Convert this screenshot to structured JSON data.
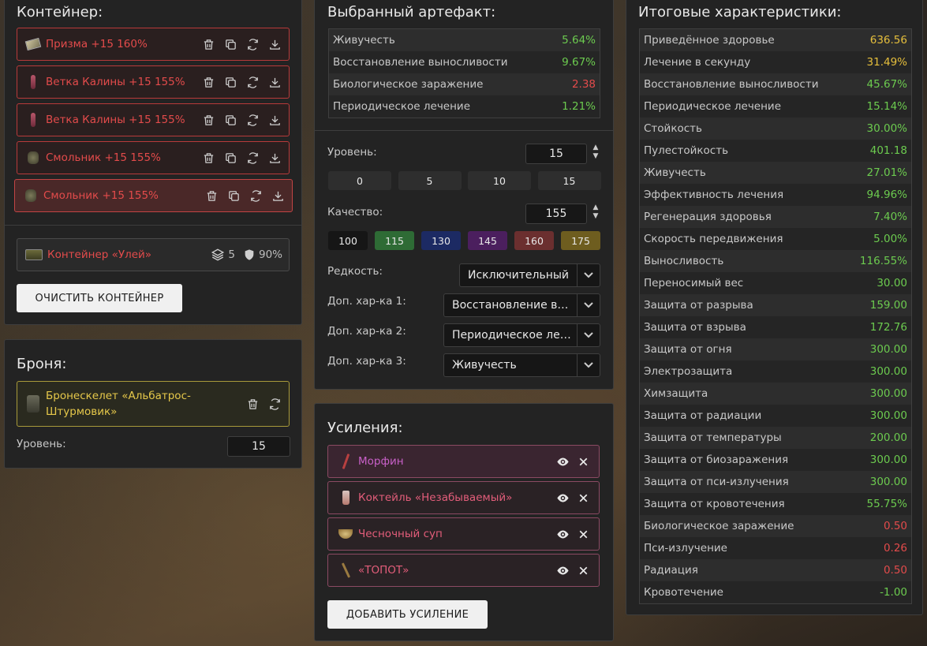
{
  "container": {
    "title": "Контейнер:",
    "items": [
      {
        "label": "Призма +15 160%",
        "icon": "prism-icon"
      },
      {
        "label": "Ветка Калины +15 155%",
        "icon": "viburnum-icon"
      },
      {
        "label": "Ветка Калины +15 155%",
        "icon": "viburnum-icon"
      },
      {
        "label": "Смольник +15 155%",
        "icon": "resin-icon"
      },
      {
        "label": "Смольник +15 155%",
        "icon": "resin-icon"
      }
    ],
    "selected": {
      "name": "Контейнер «Улей»",
      "slots": "5",
      "protection": "90%"
    },
    "clear_button": "ОЧИСТИТЬ КОНТЕЙНЕР"
  },
  "armor": {
    "title": "Броня:",
    "item_label": "Бронескелет «Альбатрос-Штурмовик»",
    "level_label": "Уровень:",
    "level_value": "15"
  },
  "artifact": {
    "title": "Выбранный артефакт:",
    "stats": [
      {
        "name": "Живучесть",
        "value": "5.64%",
        "color": "green"
      },
      {
        "name": "Восстановление выносливости",
        "value": "9.67%",
        "color": "green"
      },
      {
        "name": "Биологическое заражение",
        "value": "2.38",
        "color": "red"
      },
      {
        "name": "Периодическое лечение",
        "value": "1.21%",
        "color": "green"
      }
    ],
    "level_label": "Уровень:",
    "level_value": "15",
    "level_presets": [
      "0",
      "5",
      "10",
      "15"
    ],
    "quality_label": "Качество:",
    "quality_value": "155",
    "quality_presets": [
      {
        "label": "100",
        "color": "#161616"
      },
      {
        "label": "115",
        "color": "#2e6b35"
      },
      {
        "label": "130",
        "color": "#1c2a63"
      },
      {
        "label": "145",
        "color": "#4b1f5e"
      },
      {
        "label": "160",
        "color": "#6b2f2f"
      },
      {
        "label": "175",
        "color": "#6e5d1f"
      }
    ],
    "rarity_label": "Редкость:",
    "rarity_value": "Исключительный",
    "extra1_label": "Доп. хар-ка 1:",
    "extra1_value": "Восстановление выносливости",
    "extra2_label": "Доп. хар-ка 2:",
    "extra2_value": "Периодическое лечение",
    "extra3_label": "Доп. хар-ка 3:",
    "extra3_value": "Живучесть"
  },
  "boosts": {
    "title": "Усиления:",
    "items": [
      {
        "label": "Морфин",
        "icon": "syringe-icon"
      },
      {
        "label": "Коктейль «Незабываемый»",
        "icon": "bottle-icon"
      },
      {
        "label": "Чесночный суп",
        "icon": "soup-icon"
      },
      {
        "label": "«ТОПОТ»",
        "icon": "stick-icon"
      }
    ],
    "add_button": "ДОБАВИТЬ УСИЛЕНИЕ"
  },
  "totals": {
    "title": "Итоговые характеристики:",
    "stats": [
      {
        "name": "Приведённое здоровье",
        "value": "636.56",
        "color": "yellow"
      },
      {
        "name": "Лечение в секунду",
        "value": "31.49%",
        "color": "yellow"
      },
      {
        "name": "Восстановление выносливости",
        "value": "45.67%",
        "color": "green"
      },
      {
        "name": "Периодическое лечение",
        "value": "15.14%",
        "color": "green"
      },
      {
        "name": "Стойкость",
        "value": "30.00%",
        "color": "green"
      },
      {
        "name": "Пулестойкость",
        "value": "401.18",
        "color": "green"
      },
      {
        "name": "Живучесть",
        "value": "27.01%",
        "color": "green"
      },
      {
        "name": "Эффективность лечения",
        "value": "94.96%",
        "color": "green"
      },
      {
        "name": "Регенерация здоровья",
        "value": "7.40%",
        "color": "green"
      },
      {
        "name": "Скорость передвижения",
        "value": "5.00%",
        "color": "green"
      },
      {
        "name": "Выносливость",
        "value": "116.55%",
        "color": "green"
      },
      {
        "name": "Переносимый вес",
        "value": "30.00",
        "color": "green"
      },
      {
        "name": "Защита от разрыва",
        "value": "159.00",
        "color": "green"
      },
      {
        "name": "Защита от взрыва",
        "value": "172.76",
        "color": "green"
      },
      {
        "name": "Защита от огня",
        "value": "300.00",
        "color": "green"
      },
      {
        "name": "Электрозащита",
        "value": "300.00",
        "color": "green"
      },
      {
        "name": "Химзащита",
        "value": "300.00",
        "color": "green"
      },
      {
        "name": "Защита от радиации",
        "value": "300.00",
        "color": "green"
      },
      {
        "name": "Защита от температуры",
        "value": "200.00",
        "color": "green"
      },
      {
        "name": "Защита от биозаражения",
        "value": "300.00",
        "color": "green"
      },
      {
        "name": "Защита от пси-излучения",
        "value": "300.00",
        "color": "green"
      },
      {
        "name": "Защита от кровотечения",
        "value": "55.75%",
        "color": "green"
      },
      {
        "name": "Биологическое заражение",
        "value": "0.50",
        "color": "red"
      },
      {
        "name": "Пси-излучение",
        "value": "0.26",
        "color": "red"
      },
      {
        "name": "Радиация",
        "value": "0.50",
        "color": "red"
      },
      {
        "name": "Кровотечение",
        "value": "-1.00",
        "color": "green"
      }
    ]
  }
}
